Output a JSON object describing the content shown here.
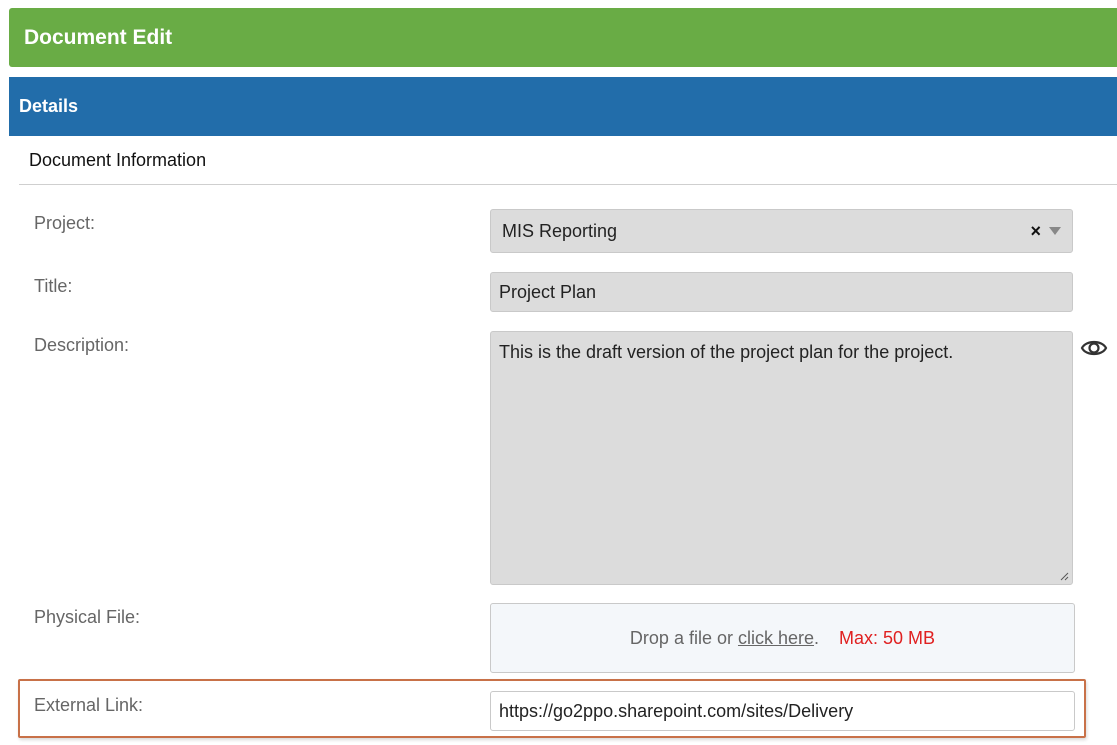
{
  "header": {
    "title": "Document Edit"
  },
  "details": {
    "title": "Details"
  },
  "section": {
    "title": "Document Information"
  },
  "fields": {
    "project": {
      "label": "Project:",
      "value": "MIS Reporting",
      "clear": "×"
    },
    "title": {
      "label": "Title:",
      "value": "Project Plan"
    },
    "description": {
      "label": "Description:",
      "value": "This is the draft version of the project plan for the project."
    },
    "physical_file": {
      "label": "Physical File:",
      "drop_text": "Drop a file or",
      "link_text": "click here",
      "after_link": ".",
      "max_text": "Max: 50 MB"
    },
    "external_link": {
      "label": "External Link:",
      "value": "https://go2ppo.sharepoint.com/sites/Delivery"
    }
  },
  "colors": {
    "header": "#69ac45",
    "details": "#226daa",
    "max_text": "#e02020",
    "highlight_border": "#c87148"
  },
  "icons": {
    "preview": "eye-icon",
    "dropdown": "chevron-down-icon"
  }
}
